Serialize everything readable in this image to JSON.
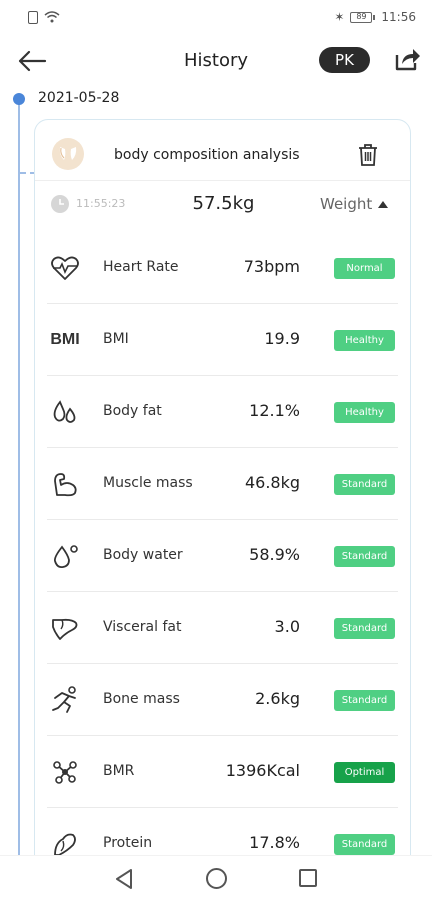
{
  "status_bar": {
    "time": "11:56",
    "battery": "89"
  },
  "header": {
    "title": "History",
    "pk_label": "PK"
  },
  "timeline": {
    "date": "2021-05-28"
  },
  "card": {
    "title": "body composition analysis",
    "time": "11:55:23",
    "weight": "57.5kg",
    "weight_toggle": "Weight"
  },
  "metrics": [
    {
      "icon": "heart-rate-icon",
      "name": "Heart Rate",
      "value": "73bpm",
      "badge": "Normal"
    },
    {
      "icon": "bmi-icon",
      "icon_text": "BMI",
      "name": "BMI",
      "value": "19.9",
      "badge": "Healthy"
    },
    {
      "icon": "body-fat-icon",
      "name": "Body fat",
      "value": "12.1%",
      "badge": "Healthy"
    },
    {
      "icon": "muscle-icon",
      "name": "Muscle mass",
      "value": "46.8kg",
      "badge": "Standard"
    },
    {
      "icon": "water-drop-icon",
      "name": "Body water",
      "value": "58.9%",
      "badge": "Standard"
    },
    {
      "icon": "visceral-fat-icon",
      "name": "Visceral fat",
      "value": "3.0",
      "badge": "Standard"
    },
    {
      "icon": "bone-icon",
      "name": "Bone mass",
      "value": "2.6kg",
      "badge": "Standard"
    },
    {
      "icon": "bmr-icon",
      "name": "BMR",
      "value": "1396Kcal",
      "badge": "Optimal"
    },
    {
      "icon": "protein-icon",
      "name": "Protein",
      "value": "17.8%",
      "badge": "Standard"
    }
  ],
  "colors": {
    "badge_green": "#4fcf83",
    "badge_optimal": "#17a24a",
    "timeline_blue": "#4a86d9",
    "pk_bg": "#2b2b2b"
  }
}
